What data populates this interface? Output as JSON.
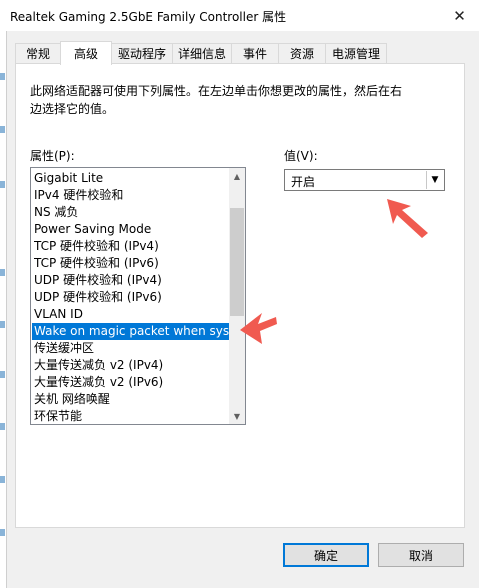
{
  "window": {
    "title": "Realtek Gaming 2.5GbE Family Controller 属性",
    "close_glyph": "✕"
  },
  "tabs": [
    {
      "label": "常规"
    },
    {
      "label": "高级"
    },
    {
      "label": "驱动程序"
    },
    {
      "label": "详细信息"
    },
    {
      "label": "事件"
    },
    {
      "label": "资源"
    },
    {
      "label": "电源管理"
    }
  ],
  "active_tab": "高级",
  "panel": {
    "description_line1": "此网络适配器可使用下列属性。在左边单击你想更改的属性，然后在右",
    "description_line2": "边选择它的值。",
    "property_label": "属性(P):",
    "value_label": "值(V):",
    "properties": [
      "Gigabit Lite",
      "IPv4 硬件校验和",
      "NS 减负",
      "Power Saving Mode",
      "TCP 硬件校验和 (IPv4)",
      "TCP 硬件校验和 (IPv6)",
      "UDP 硬件校验和 (IPv4)",
      "UDP 硬件校验和 (IPv6)",
      "VLAN ID",
      "Wake on magic packet when system",
      "传送缓冲区",
      "大量传送减负 v2 (IPv4)",
      "大量传送减负 v2 (IPv6)",
      "关机 网络唤醒",
      "环保节能"
    ],
    "selected_property_index": 9,
    "value_selected": "开启"
  },
  "buttons": {
    "ok": "确定",
    "cancel": "取消"
  },
  "colors": {
    "selection": "#0078d7",
    "annotation_arrow": "#f05a50"
  },
  "icons": {
    "scroll_up": "▲",
    "scroll_down": "▼",
    "dropdown": "▼"
  }
}
